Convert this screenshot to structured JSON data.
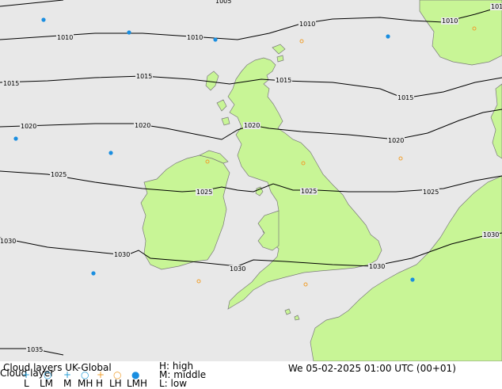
{
  "header": {
    "title": "Cloud layers UK-Global",
    "subtitle": "Cloud layer",
    "datetime": "We 05-02-2025 01:00 UTC (00+01)"
  },
  "legend": {
    "high_label": "H: high",
    "middle_label": "M: middle",
    "low_label": "L: low",
    "codes": [
      "L",
      "LM",
      "M",
      "MH",
      "H",
      "LH",
      "LMH"
    ],
    "symbols": [
      {
        "code": "L",
        "glyph": "+",
        "color": "#2aa0d8"
      },
      {
        "code": "LM",
        "glyph": "○",
        "color": "#2aa0d8"
      },
      {
        "code": "M",
        "glyph": "+",
        "color": "#2aa0d8"
      },
      {
        "code": "MH",
        "glyph": "○",
        "color": "#2aa0d8"
      },
      {
        "code": "H",
        "glyph": "+",
        "color": "#f0a030"
      },
      {
        "code": "LH",
        "glyph": "○",
        "color": "#f0a030"
      },
      {
        "code": "LMH",
        "glyph": "●",
        "color": "#1a8ee0"
      }
    ]
  },
  "isobars": {
    "color": "#000000",
    "labels": [
      "1005",
      "1010",
      "1015",
      "1020",
      "1025",
      "1030",
      "1035"
    ]
  },
  "colors": {
    "sea": "#e8e8e8",
    "land": "#c8f596",
    "coast": "#7a7a7a",
    "station_high": "#f0a030",
    "station_lmh": "#1a8ee0"
  }
}
